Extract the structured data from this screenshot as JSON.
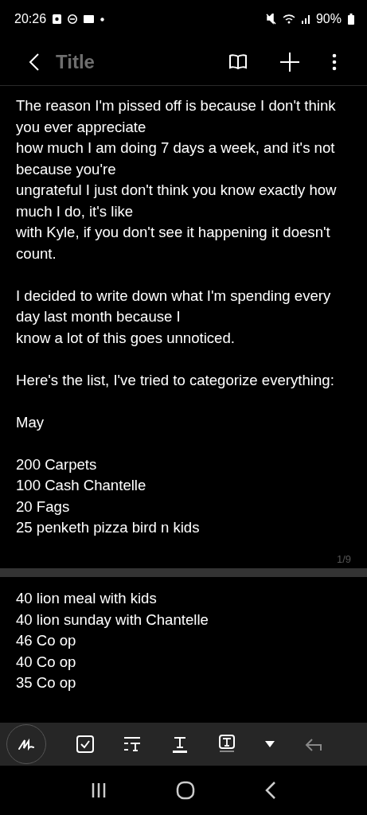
{
  "status_bar": {
    "time": "20:26",
    "battery": "90%"
  },
  "header": {
    "title": "Title"
  },
  "pages": [
    {
      "paragraphs": [
        [
          "The reason I'm pissed off is because I don't think you ever appreciate",
          "how much I am doing 7 days a week, and it's not because you're",
          "ungrateful I just don't think you know exactly how much I do, it's like",
          "with Kyle, if you don't see it happening it doesn't count."
        ],
        [
          "I decided to write down what I'm spending every day last month because I",
          "know a lot of this goes unnoticed."
        ],
        [
          "Here's the list, I've tried to categorize everything:"
        ],
        [
          "May"
        ],
        [
          "200 Carpets",
          "100 Cash Chantelle",
          "20 Fags",
          "25 penketh pizza bird n kids"
        ]
      ],
      "page_number": "1/9"
    },
    {
      "paragraphs": [
        [
          "40 lion meal with kids",
          "40 lion sunday with Chantelle",
          "46 Co op",
          "40 Co op",
          "35 Co op"
        ]
      ]
    }
  ]
}
